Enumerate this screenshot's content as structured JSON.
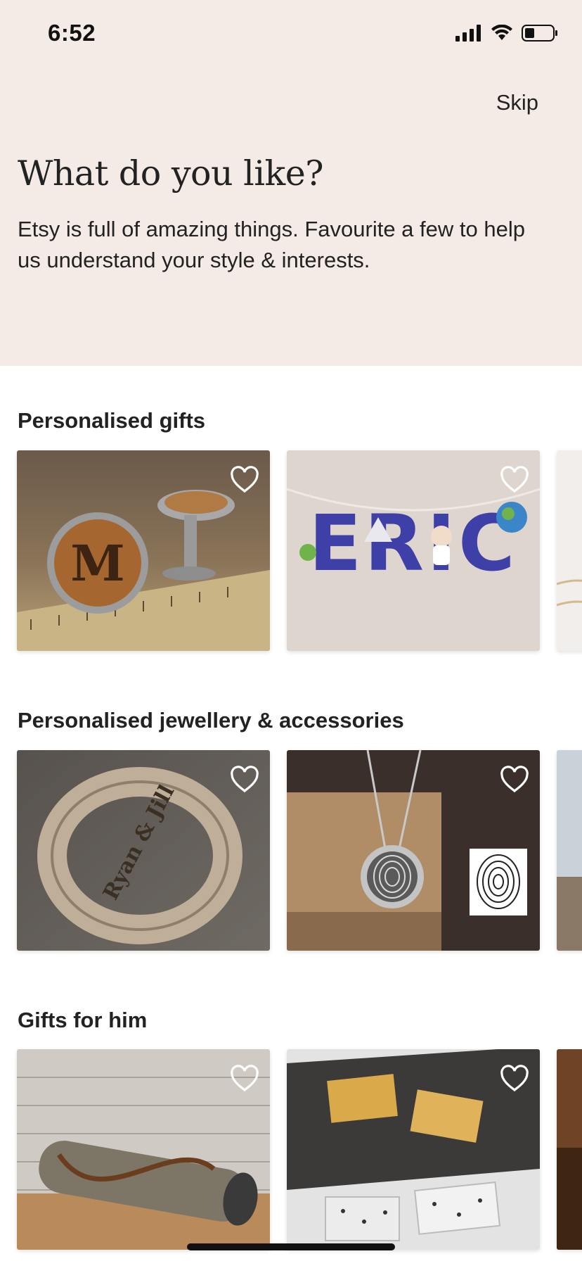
{
  "status_bar": {
    "time": "6:52",
    "icons": [
      "signal-icon",
      "wifi-icon",
      "battery-icon"
    ]
  },
  "header": {
    "skip_label": "Skip",
    "title": "What do you like?",
    "subtitle": "Etsy is full of amazing things. Favourite a few to help us understand your style & interests.",
    "background_color": "#f5ebe6"
  },
  "sections": [
    {
      "title": "Personalised gifts",
      "items": [
        "favourite-heart",
        "favourite-heart",
        "favourite-heart"
      ]
    },
    {
      "title": "Personalised jewellery & accessories",
      "items": [
        "favourite-heart",
        "favourite-heart",
        "favourite-heart"
      ]
    },
    {
      "title": "Gifts for him",
      "items": [
        "favourite-heart",
        "favourite-heart",
        "favourite-heart"
      ]
    }
  ],
  "product_texts": {
    "cufflink_letter": "M",
    "name_banner": "ERIC",
    "bracelet_engraving": "Ryan & Jill"
  }
}
